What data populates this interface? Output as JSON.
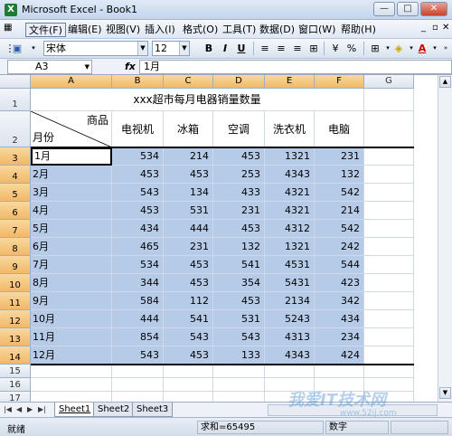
{
  "window": {
    "title": "Microsoft Excel - Book1",
    "app_icon": "X"
  },
  "menu": {
    "items": [
      "文件(F)",
      "编辑(E)",
      "视图(V)",
      "插入(I)",
      "格式(O)",
      "工具(T)",
      "数据(D)",
      "窗口(W)",
      "帮助(H)"
    ],
    "active": "文件(F)"
  },
  "toolbar": {
    "font_name": "宋体",
    "font_size": "12",
    "bold": "B",
    "italic": "I",
    "underline": "U",
    "currency": "¥",
    "percent": "%"
  },
  "formula_bar": {
    "name_box": "A3",
    "fx": "fx",
    "content": "1月"
  },
  "grid": {
    "columns": [
      "A",
      "B",
      "C",
      "D",
      "E",
      "F",
      "G"
    ],
    "rows": [
      "1",
      "2",
      "3",
      "4",
      "5",
      "6",
      "7",
      "8",
      "9",
      "10",
      "11",
      "12",
      "13",
      "14",
      "15",
      "16",
      "17"
    ],
    "title": "xxx超市每月电器销量数量",
    "diag_header": {
      "top": "商品",
      "bottom": "月份"
    },
    "headers": [
      "电视机",
      "冰箱",
      "空调",
      "洗衣机",
      "电脑"
    ],
    "data": [
      [
        "1月",
        534,
        214,
        453,
        1321,
        231
      ],
      [
        "2月",
        453,
        453,
        253,
        4343,
        132
      ],
      [
        "3月",
        543,
        134,
        433,
        4321,
        542
      ],
      [
        "4月",
        453,
        531,
        231,
        4321,
        214
      ],
      [
        "5月",
        434,
        444,
        453,
        4312,
        542
      ],
      [
        "6月",
        465,
        231,
        132,
        1321,
        242
      ],
      [
        "7月",
        534,
        453,
        541,
        4531,
        544
      ],
      [
        "8月",
        344,
        453,
        354,
        5431,
        423
      ],
      [
        "9月",
        584,
        112,
        453,
        2134,
        342
      ],
      [
        "10月",
        444,
        541,
        531,
        5243,
        434
      ],
      [
        "11月",
        854,
        543,
        543,
        4313,
        234
      ],
      [
        "12月",
        543,
        453,
        133,
        4343,
        424
      ]
    ]
  },
  "sheets": {
    "tabs": [
      "Sheet1",
      "Sheet2",
      "Sheet3"
    ],
    "active": "Sheet1"
  },
  "status": {
    "ready": "就绪",
    "sum": "求和=65495",
    "mode": "数字"
  },
  "watermark": {
    "main": "我爱IT技术网",
    "url": "www.52ij.com"
  },
  "colors": {
    "selection": "#b6cbe7",
    "header_selected": "#f1b867"
  }
}
